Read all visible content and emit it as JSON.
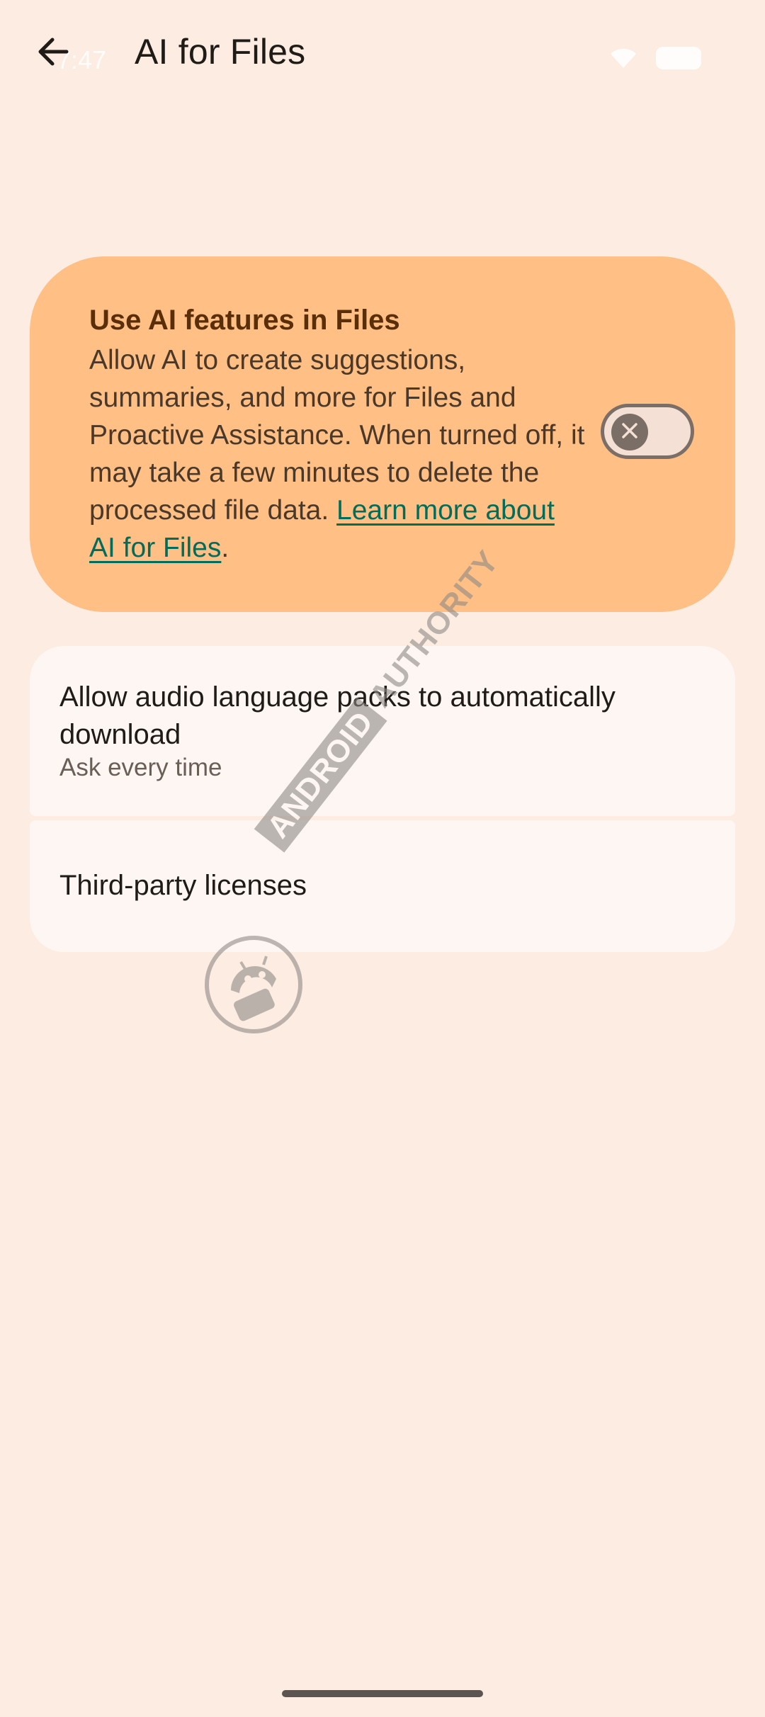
{
  "status_bar": {
    "time": "7:47"
  },
  "top_bar": {
    "title": "AI for Files"
  },
  "ai_card": {
    "title": "Use AI features in Files",
    "description": "Allow AI to create suggestions, summaries, and more for Files and Proactive Assistance. When turned off, it may take a few minutes to delete the processed file data. ",
    "link_text": "Learn more about AI for Files",
    "trailing": ".",
    "toggle_state": "off"
  },
  "settings": {
    "items": [
      {
        "title": "Allow audio language packs to automatically download",
        "subtitle": "Ask every time"
      },
      {
        "title": "Third-party licenses"
      }
    ]
  },
  "watermark": {
    "boxed_text": "ANDROID",
    "plain_text": "AUTHORITY"
  },
  "colors": {
    "background": "#fdece1",
    "card": "#ffbf85",
    "card_title": "#5a2e08",
    "link": "#006d5a",
    "list_item": "#fef6f2"
  }
}
